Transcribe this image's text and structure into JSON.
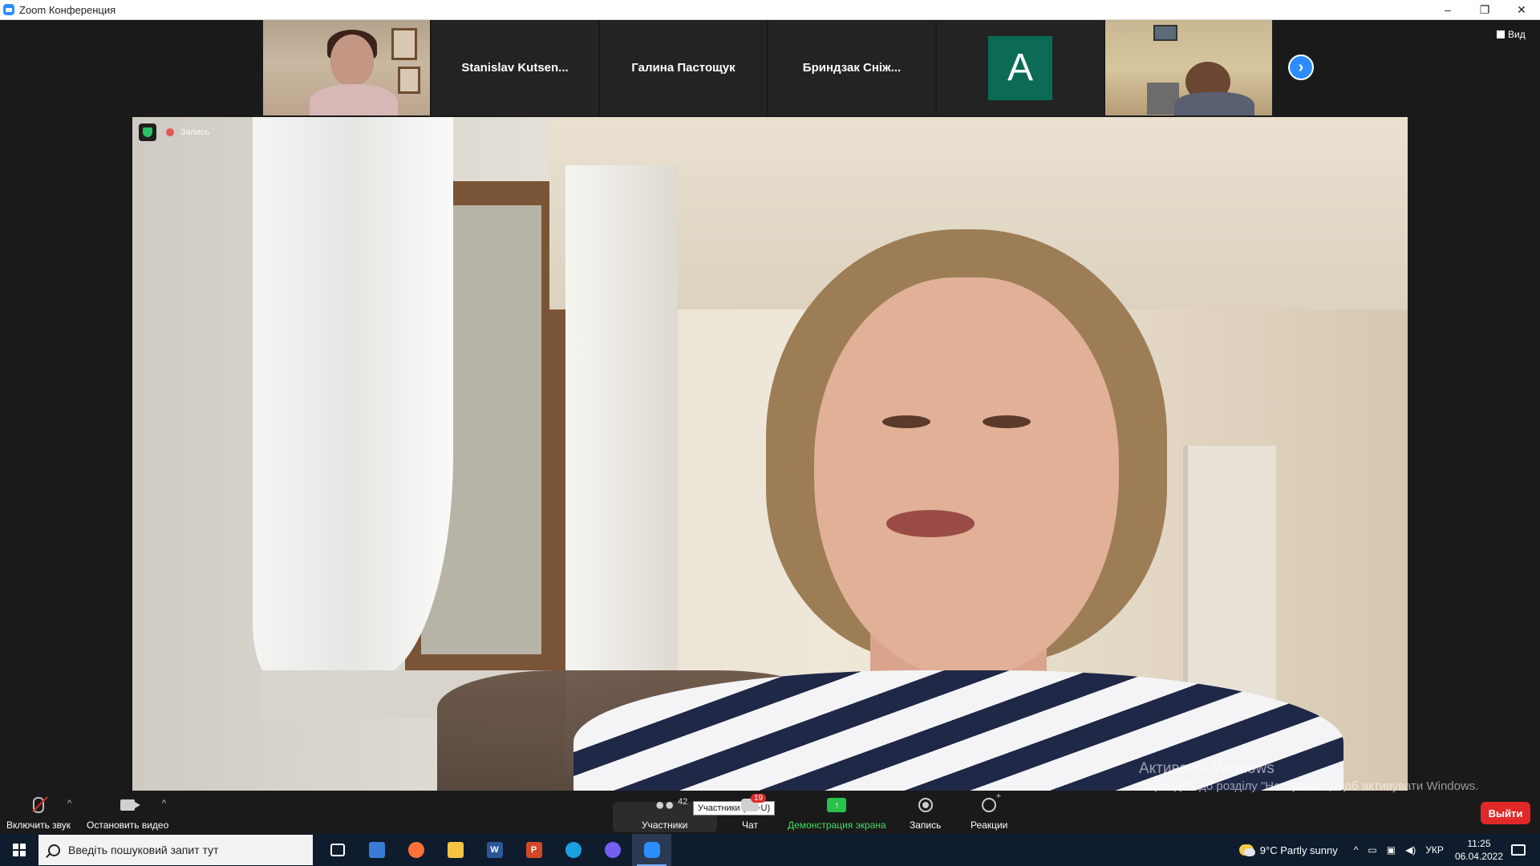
{
  "window": {
    "title": "Zoom Конференция",
    "minimize": "–",
    "restore": "❐",
    "close": "✕"
  },
  "gallery": {
    "tiles": [
      {
        "type": "video",
        "label": ""
      },
      {
        "type": "name",
        "label": "Stanislav  Kutsen..."
      },
      {
        "type": "name",
        "label": "Галина Пастощук"
      },
      {
        "type": "name",
        "label": "Бриндзак  Сніж..."
      },
      {
        "type": "avatar",
        "label": "A",
        "color": "#0b6b55"
      },
      {
        "type": "video",
        "label": ""
      }
    ],
    "next": "›",
    "view_label": "Вид"
  },
  "main_video": {
    "recording_label": "Запись"
  },
  "watermark": {
    "title": "Активація Windows",
    "subtitle": "Перейдіть до розділу \"Настройки\", щоб активувати Windows."
  },
  "toolbar": {
    "unmute_label": "Включить звук",
    "stop_video_label": "Остановить видео",
    "participants_label": "Участники",
    "participants_count": "42",
    "participants_tooltip": "Участники (Alt+U)",
    "chat_label": "Чат",
    "chat_badge": "19",
    "share_label": "Демонстрация экрана",
    "record_label": "Запись",
    "reactions_label": "Реакции",
    "leave_label": "Выйти",
    "accent_color": "#2d8cff",
    "share_color": "#27c24b",
    "leave_color": "#e02828"
  },
  "taskbar": {
    "search_placeholder": "Введіть пошуковий запит тут",
    "weather": "9°C  Partly sunny",
    "language": "УКР",
    "time": "11:25",
    "date": "06.04.2022"
  }
}
